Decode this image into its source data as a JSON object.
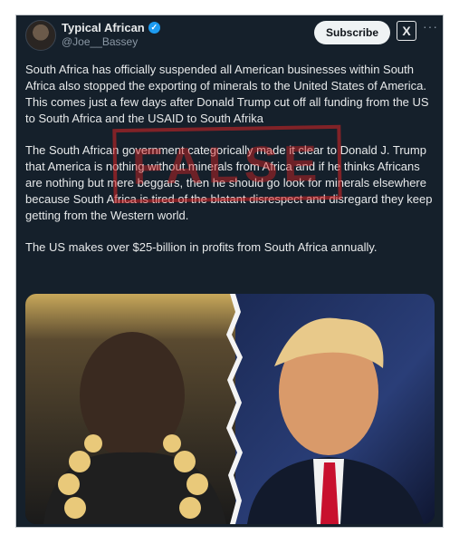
{
  "post": {
    "author_name": "Typical African",
    "author_handle": "@Joe__Bassey",
    "subscribe_label": "Subscribe",
    "x_logo_glyph": "X",
    "more_glyph": "···",
    "verified_glyph": "✓",
    "paragraphs": [
      "South Africa has officially suspended all American businesses within South Africa also stopped the exporting of minerals to the United States of America.",
      "This comes just a few days after Donald Trump cut off all funding from the US to South Africa and the USAID to South Afrika",
      "The South African government categorically made it clear to Donald J. Trump that America is nothing without minerals from Africa and if he thinks Africans are nothing but mere beggars, then he should go look for minerals elsewhere because South Africa is tired of the blatant disrespect and disregard they keep getting from the Western world.",
      "The US makes over $25-billion in profits from South Africa annually."
    ]
  },
  "stamp": {
    "label": "FALSE",
    "color": "#da2424"
  },
  "colors": {
    "card_bg": "#15202b",
    "text": "#e7e9ea",
    "muted": "#8b98a5",
    "verified": "#1d9bf0"
  },
  "icons": {
    "avatar": "profile-photo",
    "verified": "verified-badge-icon",
    "x": "x-logo-icon",
    "more": "more-options-icon"
  }
}
